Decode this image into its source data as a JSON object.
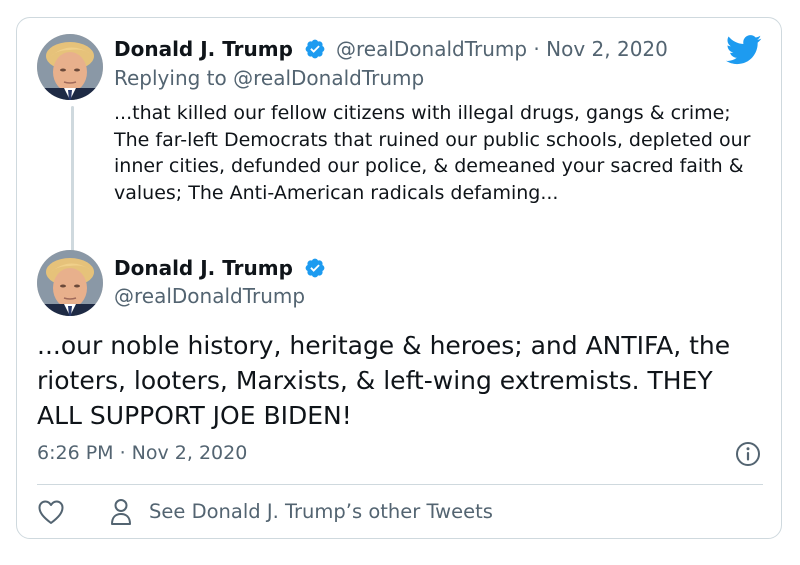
{
  "colors": {
    "verified": "#1d9bf0",
    "twitter_brand": "#1d9bf0",
    "secondary_text": "#536471",
    "border": "#cfd9de"
  },
  "reply_tweet": {
    "author_name": "Donald J. Trump",
    "handle_and_date": "@realDonaldTrump · Nov 2, 2020",
    "replying_prefix": "Replying to ",
    "replying_handle": "@realDonaldTrump",
    "text": "...that killed our fellow citizens with illegal drugs, gangs & crime; The far-left Democrats that ruined our public schools, depleted our inner cities, defunded our police, & demeaned your sacred faith & values; The Anti-American radicals defaming..."
  },
  "main_tweet": {
    "author_name": "Donald J. Trump",
    "handle": "@realDonaldTrump",
    "text": "...our noble history, heritage & heroes; and ANTIFA, the rioters, looters, Marxists, & left-wing extremists. THEY ALL SUPPORT JOE BIDEN!",
    "timestamp": "6:26 PM · Nov 2, 2020"
  },
  "actions": {
    "other_tweets_label": "See Donald J. Trump’s other Tweets"
  },
  "icons": {
    "brand": "twitter-bird-icon",
    "verified": "verified-badge-icon",
    "info": "info-icon",
    "like": "heart-icon",
    "profile": "person-icon"
  }
}
